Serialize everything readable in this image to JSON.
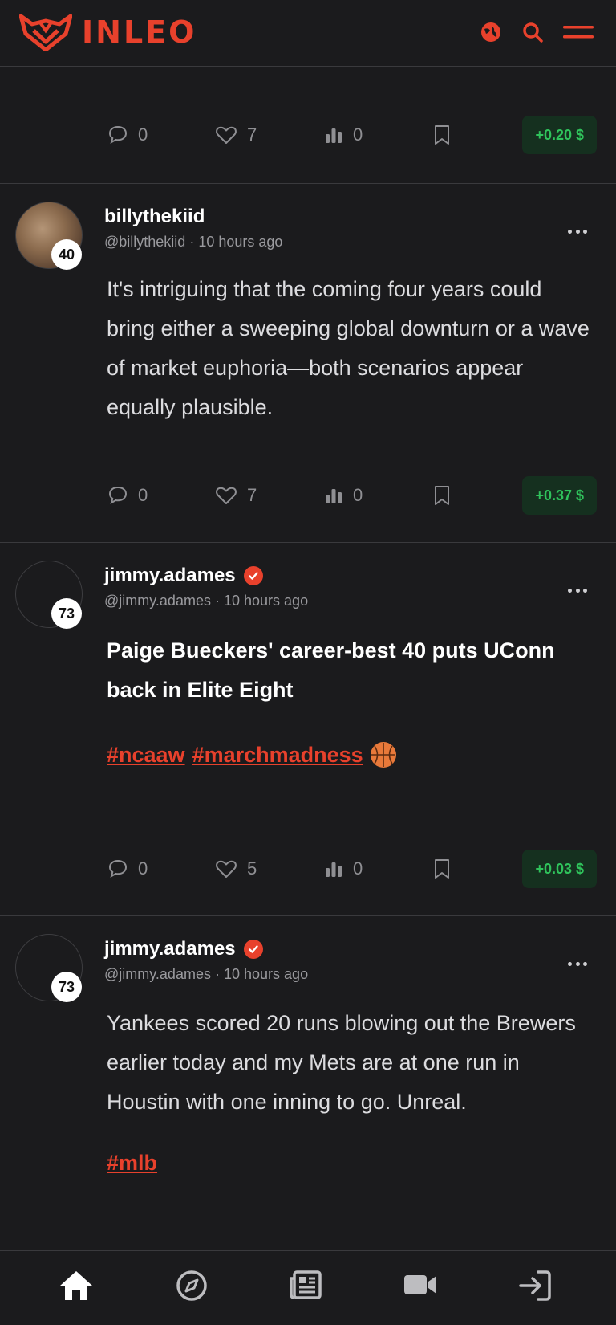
{
  "brand": {
    "name": "INLEO",
    "accent": "#e8412c"
  },
  "header_icons": [
    "globe-icon",
    "search-icon",
    "menu-icon"
  ],
  "posts": [
    {
      "stats": {
        "comments": "0",
        "likes": "7",
        "votes": "0",
        "payout": "+0.20 $"
      }
    },
    {
      "author": "billythekiid",
      "handle": "@billythekiid",
      "time": "10 hours ago",
      "reputation": "40",
      "text": "It's intriguing that the coming four years could bring either a sweeping global downturn or a wave of market euphoria—both scenarios appear equally plausible.",
      "stats": {
        "comments": "0",
        "likes": "7",
        "votes": "0",
        "payout": "+0.37 $"
      }
    },
    {
      "author": "jimmy.adames",
      "handle": "@jimmy.adames",
      "time": "10 hours ago",
      "reputation": "73",
      "title": "Paige Bueckers' career-best 40 puts UConn back in Elite Eight",
      "tags": [
        "#ncaaw",
        "#marchmadness"
      ],
      "stats": {
        "comments": "0",
        "likes": "5",
        "votes": "0",
        "payout": "+0.03 $"
      }
    },
    {
      "author": "jimmy.adames",
      "handle": "@jimmy.adames",
      "time": "10 hours ago",
      "reputation": "73",
      "text": "Yankees scored 20 runs blowing out the Brewers earlier today and my Mets are at one run in Houstin with one inning to go. Unreal.",
      "tags": [
        "#mlb"
      ]
    }
  ],
  "meta_sep": "·",
  "bottom_nav": [
    "home-icon",
    "explore-icon",
    "articles-icon",
    "video-icon",
    "login-icon"
  ],
  "colors": {
    "background": "#1b1b1d",
    "payout_bg": "#15301f",
    "payout_text": "#2fc25b"
  }
}
